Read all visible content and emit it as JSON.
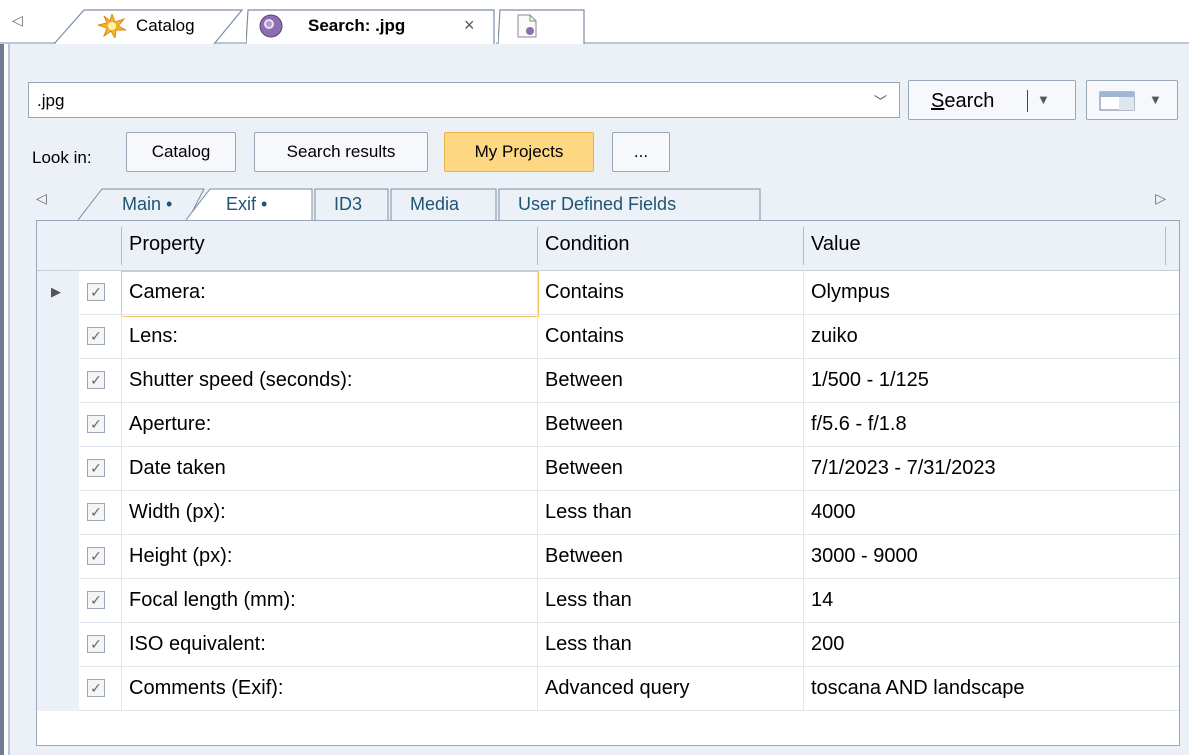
{
  "doc_tabs": {
    "catalog_label": "Catalog",
    "search_label": "Search: .jpg",
    "close_glyph": "×"
  },
  "search": {
    "query": ".jpg",
    "button_label_prefix": "S",
    "button_label_rest": "earch"
  },
  "look_in": {
    "label": "Look in:",
    "options": [
      "Catalog",
      "Search results",
      "My Projects",
      "..."
    ],
    "selected": "My Projects"
  },
  "criteria_tabs": [
    "Main •",
    "Exif •",
    "ID3",
    "Media",
    "User Defined Fields"
  ],
  "criteria_selected": "Exif •",
  "grid": {
    "columns": [
      "Property",
      "Condition",
      "Value"
    ],
    "rows": [
      {
        "checked": true,
        "property": "Camera:",
        "condition": "Contains",
        "value": "Olympus"
      },
      {
        "checked": true,
        "property": "Lens:",
        "condition": "Contains",
        "value": "zuiko"
      },
      {
        "checked": true,
        "property": "Shutter speed (seconds):",
        "condition": "Between",
        "value": "1/500 - 1/125"
      },
      {
        "checked": true,
        "property": "Aperture:",
        "condition": "Between",
        "value": "f/5.6 - f/1.8"
      },
      {
        "checked": true,
        "property": "Date taken",
        "condition": "Between",
        "value": "7/1/2023 - 7/31/2023"
      },
      {
        "checked": true,
        "property": "Width (px):",
        "condition": "Less than",
        "value": "4000"
      },
      {
        "checked": true,
        "property": "Height (px):",
        "condition": "Between",
        "value": "3000 - 9000"
      },
      {
        "checked": true,
        "property": "Focal length (mm):",
        "condition": "Less than",
        "value": "14"
      },
      {
        "checked": true,
        "property": "ISO equivalent:",
        "condition": "Less than",
        "value": "200"
      },
      {
        "checked": true,
        "property": "Comments (Exif):",
        "condition": "Advanced query",
        "value": "toscana AND landscape"
      }
    ]
  },
  "icons": {
    "catalog": "starburst-icon",
    "search": "search-globe-icon",
    "new_tab": "new-document-icon",
    "layout": "window-layout-icon"
  },
  "colors": {
    "panel_bg": "#ecf1f8",
    "active_location": "#fdd782",
    "tab_text": "#1f5472",
    "focus_border": "#f0c96a"
  }
}
